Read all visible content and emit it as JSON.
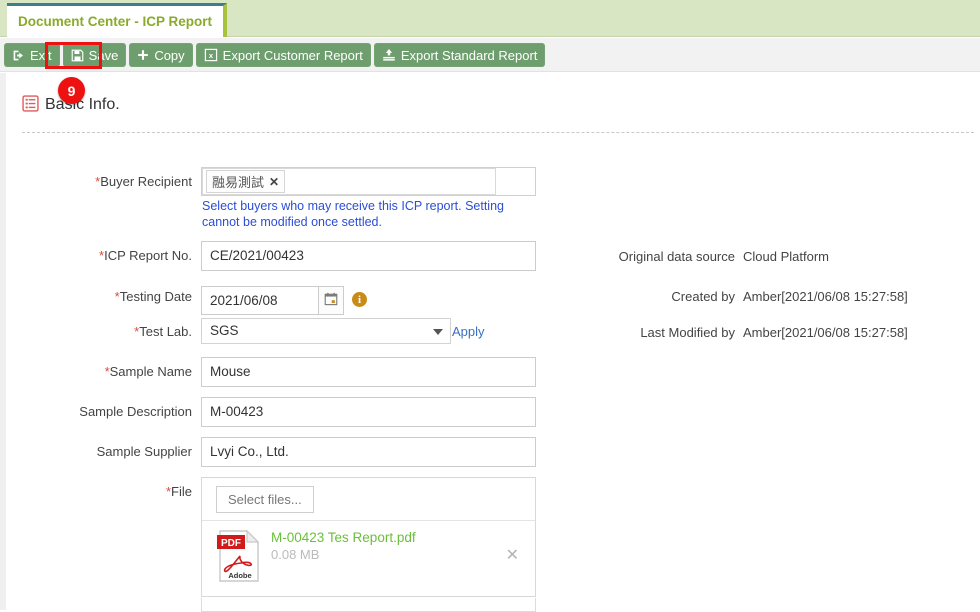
{
  "tab": {
    "label": "Document Center - ICP Report"
  },
  "toolbar": {
    "exit_label": "Exit",
    "save_label": "Save",
    "copy_label": "Copy",
    "export_customer_label": "Export Customer Report",
    "export_standard_label": "Export Standard Report"
  },
  "annotation": {
    "step_number": "9"
  },
  "section": {
    "title": "Basic Info."
  },
  "form": {
    "buyer_recipient": {
      "label": "Buyer Recipient",
      "required": true,
      "chips": [
        {
          "text": "融易測試",
          "remove": "✕"
        }
      ],
      "hint": "Select buyers who may receive this ICP report. Setting cannot be modified once settled."
    },
    "icp_report_no": {
      "label": "ICP Report No.",
      "required": true,
      "value": "CE/2021/00423"
    },
    "testing_date": {
      "label": "Testing Date",
      "required": true,
      "value": "2021/06/08",
      "info": "i"
    },
    "test_lab": {
      "label": "Test Lab.",
      "required": true,
      "value": "SGS",
      "apply_label": "Apply"
    },
    "sample_name": {
      "label": "Sample Name",
      "required": true,
      "value": "Mouse"
    },
    "sample_description": {
      "label": "Sample Description",
      "required": false,
      "value": "M-00423"
    },
    "sample_supplier": {
      "label": "Sample Supplier",
      "required": false,
      "value": "Lvyi Co., Ltd."
    },
    "file": {
      "label": "File",
      "required": true,
      "select_button": "Select files...",
      "attachment": {
        "name": "M-00423 Tes Report.pdf",
        "size": "0.08 MB",
        "type_badge": "PDF",
        "type_brand": "Adobe",
        "remove": "✕"
      }
    }
  },
  "meta": [
    {
      "label": "Original data source",
      "value": "Cloud Platform"
    },
    {
      "label": "Created by",
      "value": "Amber[2021/06/08 15:27:58]"
    },
    {
      "label": "Last Modified by",
      "value": "Amber[2021/06/08 15:27:58]"
    }
  ],
  "colors": {
    "tab_strip": "#d9e6c4",
    "tab_text": "#8aaa2b",
    "toolbar_button": "#6e9e6e",
    "highlight": "#ee1111",
    "hint_text": "#2b4ed6",
    "file_link": "#6bbf3a",
    "link": "#3a6fc4"
  }
}
